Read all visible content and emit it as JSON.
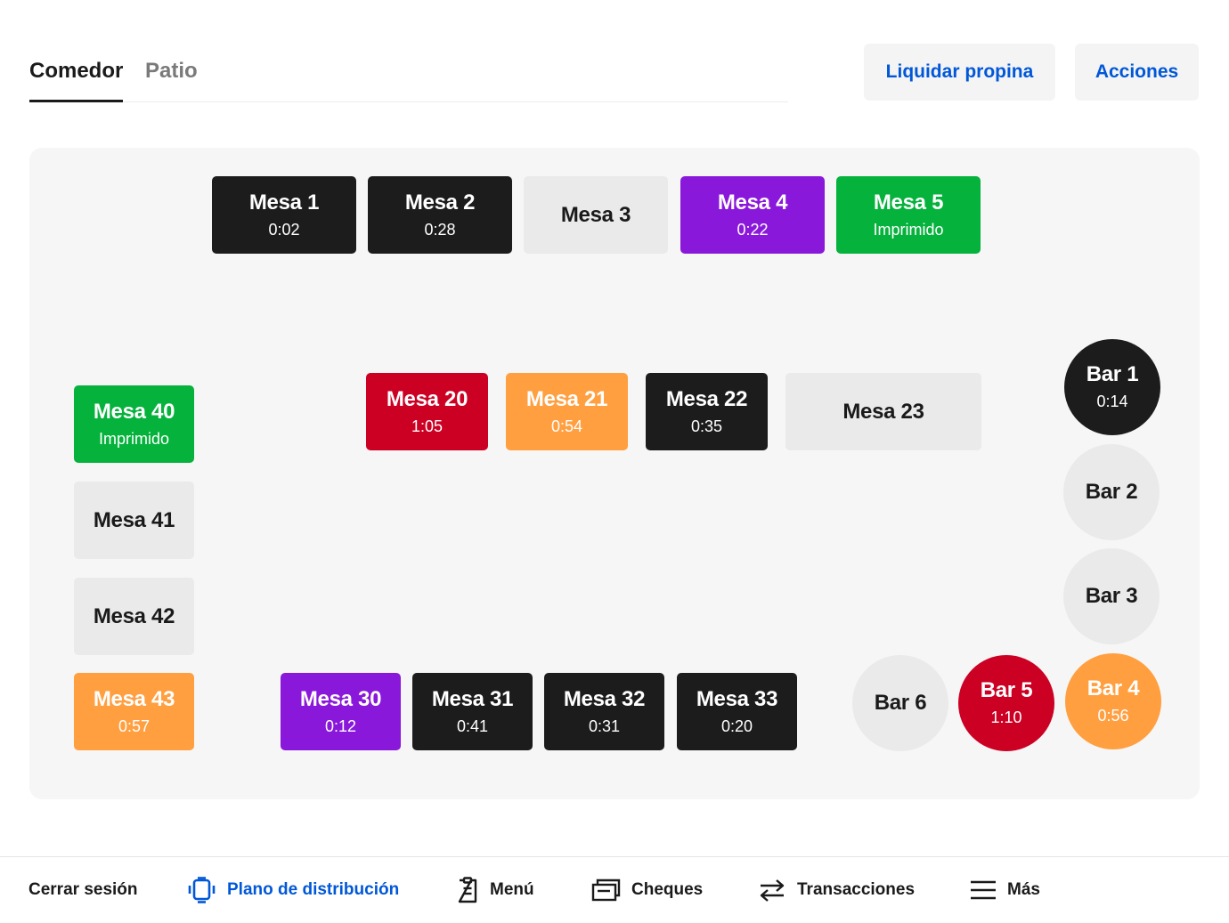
{
  "tabs": [
    {
      "label": "Comedor",
      "active": true
    },
    {
      "label": "Patio",
      "active": false
    }
  ],
  "actions": {
    "tip_label": "Liquidar propina",
    "actions_label": "Acciones"
  },
  "colors": {
    "accent": "#0057d8",
    "occupied": "#1c1c1c",
    "empty": "#eaeaea",
    "purple": "#8a18da",
    "printed": "#05b23c",
    "overdue": "#cc0023",
    "warning": "#ff9f40"
  },
  "tables": [
    {
      "name": "Mesa 1",
      "status": "0:02",
      "color": "black"
    },
    {
      "name": "Mesa 2",
      "status": "0:28",
      "color": "black"
    },
    {
      "name": "Mesa 3",
      "status": "",
      "color": "empty"
    },
    {
      "name": "Mesa 4",
      "status": "0:22",
      "color": "purple"
    },
    {
      "name": "Mesa 5",
      "status": "Imprimido",
      "color": "green"
    },
    {
      "name": "Mesa 40",
      "status": "Imprimido",
      "color": "green"
    },
    {
      "name": "Mesa 41",
      "status": "",
      "color": "empty"
    },
    {
      "name": "Mesa 42",
      "status": "",
      "color": "empty"
    },
    {
      "name": "Mesa 43",
      "status": "0:57",
      "color": "orange"
    },
    {
      "name": "Mesa 20",
      "status": "1:05",
      "color": "red"
    },
    {
      "name": "Mesa 21",
      "status": "0:54",
      "color": "orange"
    },
    {
      "name": "Mesa 22",
      "status": "0:35",
      "color": "black"
    },
    {
      "name": "Mesa 23",
      "status": "",
      "color": "empty"
    },
    {
      "name": "Mesa 30",
      "status": "0:12",
      "color": "purple"
    },
    {
      "name": "Mesa 31",
      "status": "0:41",
      "color": "black"
    },
    {
      "name": "Mesa 32",
      "status": "0:31",
      "color": "black"
    },
    {
      "name": "Mesa 33",
      "status": "0:20",
      "color": "black"
    },
    {
      "name": "Bar 1",
      "status": "0:14",
      "color": "black"
    },
    {
      "name": "Bar 2",
      "status": "",
      "color": "empty"
    },
    {
      "name": "Bar 3",
      "status": "",
      "color": "empty"
    },
    {
      "name": "Bar 4",
      "status": "0:56",
      "color": "orange"
    },
    {
      "name": "Bar 5",
      "status": "1:10",
      "color": "red"
    },
    {
      "name": "Bar 6",
      "status": "",
      "color": "empty"
    }
  ],
  "bottom_nav": [
    {
      "label": "Cerrar sesión",
      "icon": "",
      "active": false
    },
    {
      "label": "Plano de distribución",
      "icon": "floor-plan-icon",
      "active": true
    },
    {
      "label": "Menú",
      "icon": "menu-clipboard-icon",
      "active": false
    },
    {
      "label": "Cheques",
      "icon": "checks-icon",
      "active": false
    },
    {
      "label": "Transacciones",
      "icon": "transfer-arrows-icon",
      "active": false
    },
    {
      "label": "Más",
      "icon": "hamburger-icon",
      "active": false
    }
  ]
}
